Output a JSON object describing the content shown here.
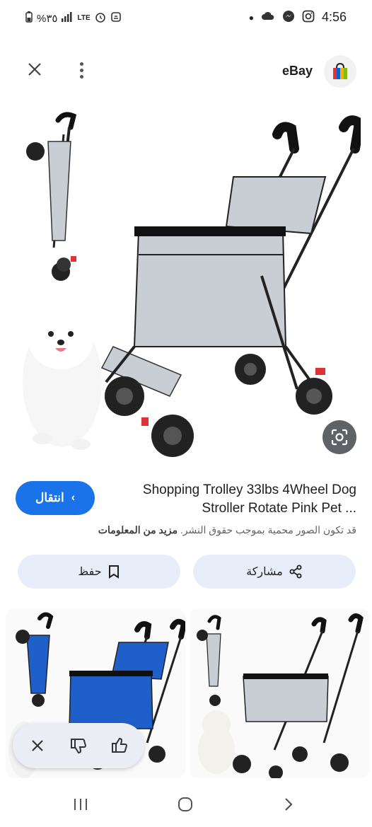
{
  "status_bar": {
    "battery_percent": "%٣٥",
    "network": "LTE",
    "time": "4:56"
  },
  "header": {
    "source_name": "eBay",
    "icons": [
      "close-icon",
      "more-vert-icon",
      "ebay-bag-logo"
    ]
  },
  "result": {
    "title": "Shopping Trolley 33lbs 4Wheel Dog Stroller Rotate Pink Pet ...",
    "visit_label": "انتقال",
    "copyright_notice": "قد تكون الصور محمية بموجب حقوق النشر.",
    "more_info_label": "مزيد من المعلومات"
  },
  "actions": {
    "save_label": "حفظ",
    "share_label": "مشاركة"
  },
  "colors": {
    "accent": "#1a73e8",
    "action_bg": "#e8eef9",
    "stroller_grey": "#c9ced4",
    "stroller_blue": "#1f5fc9"
  }
}
